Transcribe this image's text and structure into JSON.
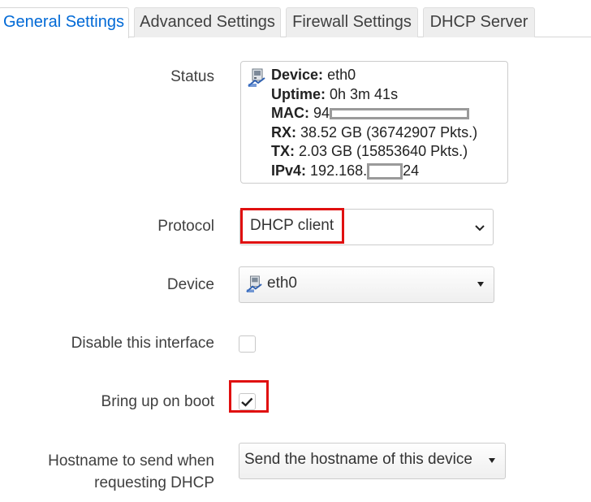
{
  "tabs": [
    {
      "label": "General Settings",
      "active": true
    },
    {
      "label": "Advanced Settings",
      "active": false
    },
    {
      "label": "Firewall Settings",
      "active": false
    },
    {
      "label": "DHCP Server",
      "active": false
    }
  ],
  "status": {
    "label": "Status",
    "device_key": "Device:",
    "device_val": "eth0",
    "uptime_key": "Uptime:",
    "uptime_val": "0h 3m 41s",
    "mac_key": "MAC:",
    "mac_val": "94",
    "rx_key": "RX:",
    "rx_val": "38.52 GB (36742907 Pkts.)",
    "tx_key": "TX:",
    "tx_val": "2.03 GB (15853640 Pkts.)",
    "ipv4_key": "IPv4:",
    "ipv4_val_a": "192.168.",
    "ipv4_val_b": "24"
  },
  "protocol": {
    "label": "Protocol",
    "value": "DHCP client"
  },
  "device": {
    "label": "Device",
    "value": "eth0",
    "icon": "network-adapter-icon"
  },
  "disable": {
    "label": "Disable this interface",
    "checked": false
  },
  "boot": {
    "label": "Bring up on boot",
    "checked": true
  },
  "hostname": {
    "label_1": "Hostname to send when",
    "label_2": "requesting DHCP",
    "value": "Send the hostname of this device"
  },
  "colors": {
    "accent": "#0069d6",
    "highlight": "#e01010"
  }
}
